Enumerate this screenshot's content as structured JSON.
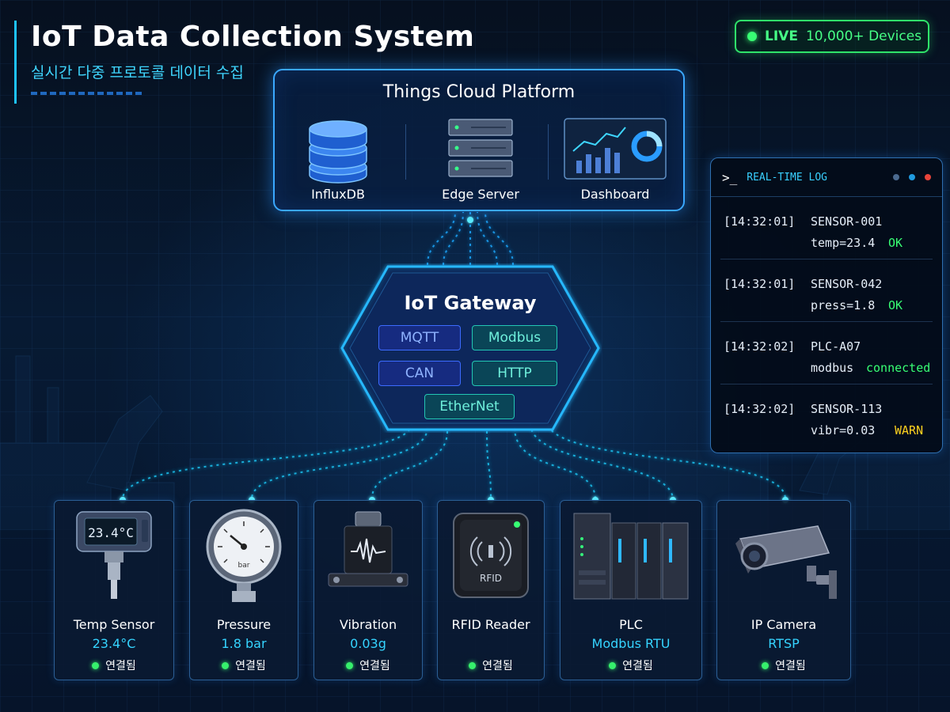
{
  "header": {
    "title": "IoT Data Collection System",
    "subtitle": "실시간 다중 프로토콜 데이터 수집"
  },
  "live": {
    "label": "LIVE",
    "devices": "10,000+ Devices"
  },
  "cloud": {
    "title": "Things Cloud Platform",
    "items": [
      {
        "label": "InfluxDB",
        "icon": "database-icon"
      },
      {
        "label": "Edge Server",
        "icon": "server-icon"
      },
      {
        "label": "Dashboard",
        "icon": "dashboard-icon"
      }
    ]
  },
  "gateway": {
    "title": "IoT Gateway",
    "protocols": [
      "MQTT",
      "Modbus",
      "CAN",
      "HTTP",
      "EtherNet"
    ]
  },
  "log": {
    "prompt": ">_",
    "title": "REAL-TIME LOG",
    "entries": [
      {
        "time": "[14:32:01]",
        "source": "SENSOR-001",
        "metric": "temp=23.4",
        "status": "OK"
      },
      {
        "time": "[14:32:01]",
        "source": "SENSOR-042",
        "metric": "press=1.8",
        "status": "OK"
      },
      {
        "time": "[14:32:02]",
        "source": "PLC-A07",
        "metric": "modbus",
        "status": "connected"
      },
      {
        "time": "[14:32:02]",
        "source": "SENSOR-113",
        "metric": "vibr=0.03",
        "status": "WARN"
      }
    ]
  },
  "devices": [
    {
      "name": "Temp Sensor",
      "value": "23.4°C",
      "status": "연결됨",
      "display": "23.4°C"
    },
    {
      "name": "Pressure",
      "value": "1.8 bar",
      "status": "연결됨",
      "gauge_unit": "bar"
    },
    {
      "name": "Vibration",
      "value": "0.03g",
      "status": "연결됨"
    },
    {
      "name": "RFID Reader",
      "value": "",
      "status": "연결됨",
      "device_label": "RFID"
    },
    {
      "name": "PLC",
      "value": "Modbus RTU",
      "status": "연결됨"
    },
    {
      "name": "IP Camera",
      "value": "RTSP",
      "status": "연결됨"
    }
  ],
  "colors": {
    "accent": "#1ec3ff",
    "live_green": "#38ff74",
    "ok": "#38ff74",
    "warn": "#ffd21f",
    "frame": "#3aa8ff"
  }
}
